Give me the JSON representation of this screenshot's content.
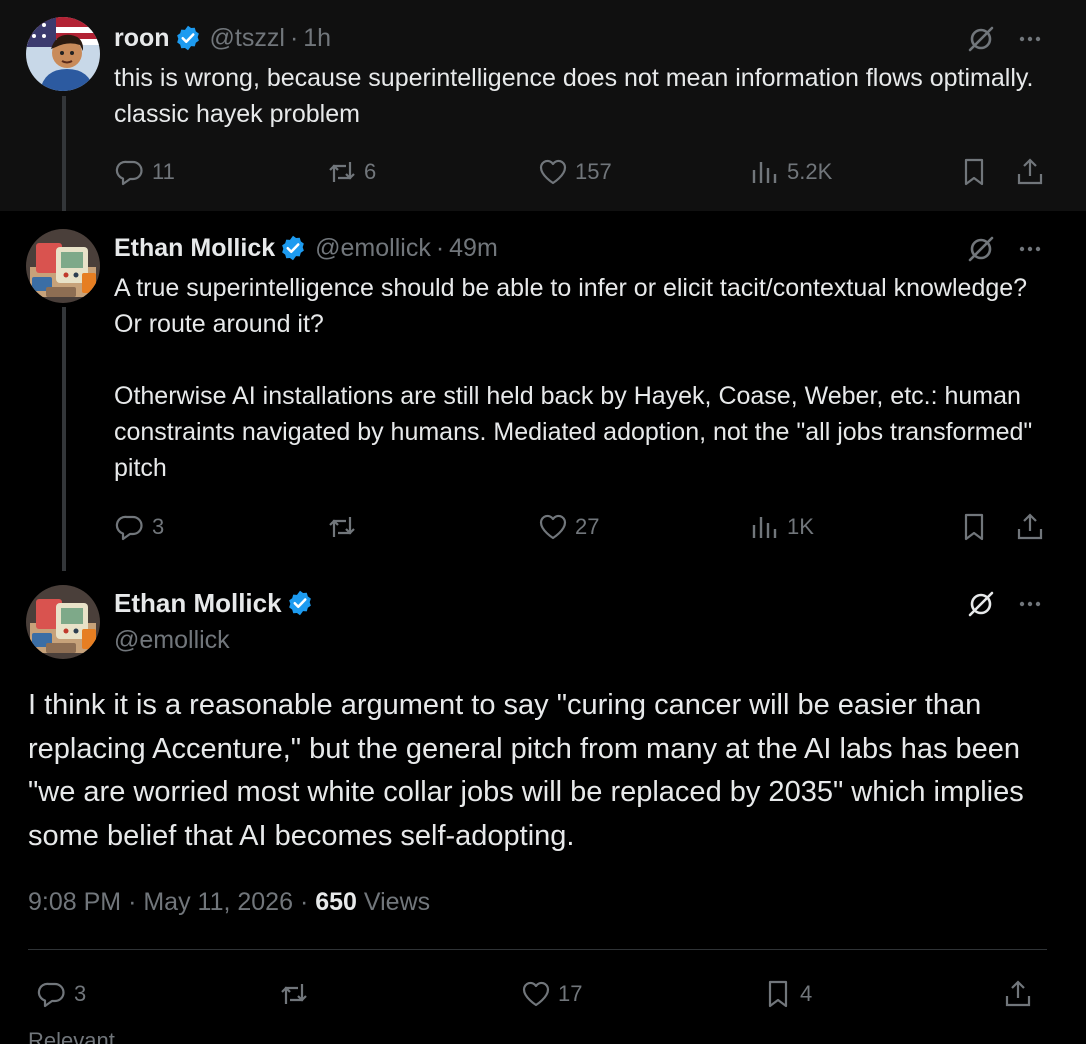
{
  "tweets": [
    {
      "name": "roon",
      "handle": "@tszzl",
      "separator": "·",
      "time": "1h",
      "text": [
        "this is wrong, because superintelligence does not mean information flows optimally. classic hayek problem"
      ],
      "stats": {
        "replies": "11",
        "reposts": "6",
        "likes": "157",
        "views": "5.2K"
      }
    },
    {
      "name": "Ethan Mollick",
      "handle": "@emollick",
      "separator": "·",
      "time": "49m",
      "text": [
        "A true superintelligence should be able to infer or elicit tacit/contextual knowledge? Or route around it?",
        "Otherwise AI installations are still held back by Hayek, Coase, Weber, etc.: human constraints navigated by humans.  Mediated adoption, not the \"all jobs transformed\" pitch"
      ],
      "stats": {
        "replies": "3",
        "reposts": "",
        "likes": "27",
        "views": "1K"
      }
    }
  ],
  "main": {
    "name": "Ethan Mollick",
    "handle": "@emollick",
    "text": "I think it is a reasonable argument to say \"curing cancer will be easier than replacing Accenture,\" but the general pitch from many at the AI labs has been \"we are worried most white collar jobs will be replaced by 2035\" which implies some belief that AI becomes self-adopting.",
    "time": "9:08 PM",
    "separator": "·",
    "date": "May 11, 2026",
    "views_count": "650",
    "views_label": "Views",
    "stats": {
      "replies": "3",
      "reposts": "",
      "likes": "17",
      "bookmarks": "4"
    },
    "cut_off_text": "Relevant"
  },
  "icons": {
    "verified": "verified-badge-icon",
    "grok": "grok-icon",
    "more": "more-icon",
    "reply": "reply-icon",
    "repost": "repost-icon",
    "like": "heart-icon",
    "views": "views-icon",
    "bookmark": "bookmark-icon",
    "share": "share-icon"
  },
  "colors": {
    "background": "#000000",
    "highlighted_tweet_background": "#101010",
    "text": "#e7e9ea",
    "secondary_text": "#71767b",
    "verified_blue": "#1d9bf0",
    "divider": "#2f3336"
  }
}
